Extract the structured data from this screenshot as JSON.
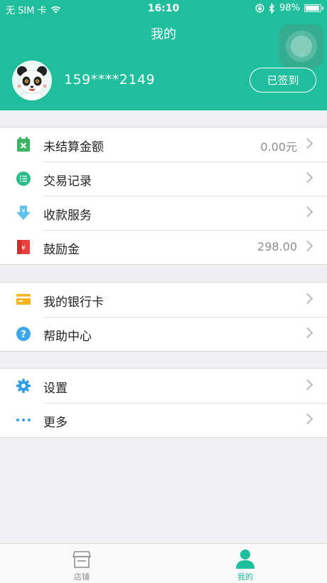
{
  "status_bar": {
    "carrier": "无 SIM 卡",
    "time": "16:10",
    "battery": "98%"
  },
  "header": {
    "title": "我的",
    "phone": "159****2149",
    "signin_label": "已签到"
  },
  "colors": {
    "brand": "#1fbe9c",
    "tab_active": "#1fbe9c",
    "tab_inactive": "#8e8e93"
  },
  "groups": [
    {
      "items": [
        {
          "icon": "calendar-x-icon",
          "label": "未结算金额",
          "value": "0.00元"
        },
        {
          "icon": "list-icon",
          "label": "交易记录",
          "value": ""
        },
        {
          "icon": "download-yen-icon",
          "label": "收款服务",
          "value": ""
        },
        {
          "icon": "red-envelope-icon",
          "label": "鼓励金",
          "value": "298.00"
        }
      ]
    },
    {
      "items": [
        {
          "icon": "bank-card-icon",
          "label": "我的银行卡",
          "value": ""
        },
        {
          "icon": "help-icon",
          "label": "帮助中心",
          "value": ""
        }
      ]
    },
    {
      "items": [
        {
          "icon": "gear-icon",
          "label": "设置",
          "value": ""
        },
        {
          "icon": "more-dots-icon",
          "label": "更多",
          "value": ""
        }
      ]
    }
  ],
  "tabbar": {
    "tabs": [
      {
        "label": "店铺",
        "icon": "store-icon"
      },
      {
        "label": "我的",
        "icon": "person-icon",
        "active": true
      }
    ]
  }
}
